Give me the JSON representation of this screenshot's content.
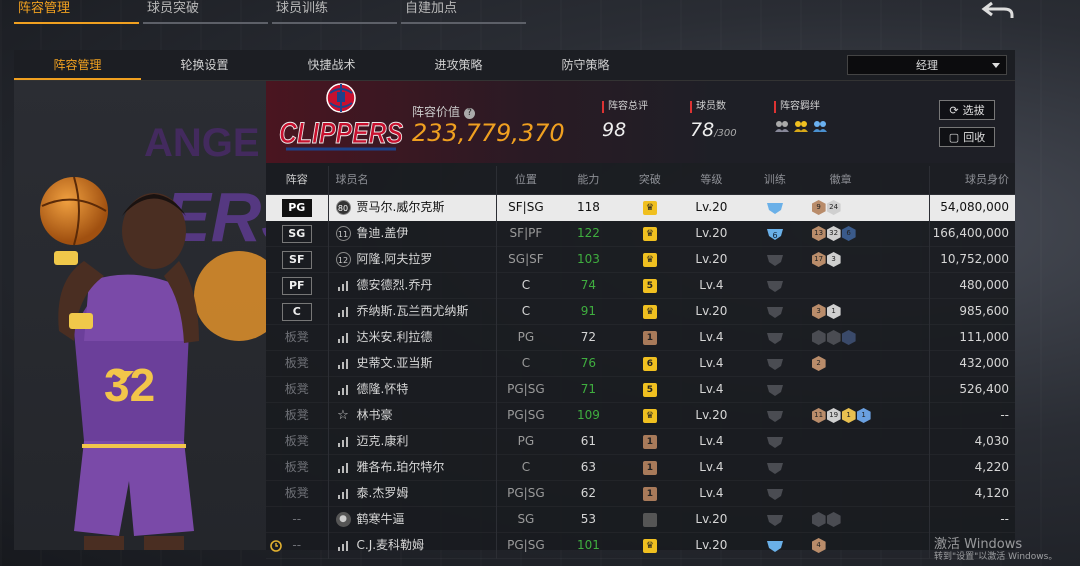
{
  "top_tabs": [
    {
      "label": "阵容管理",
      "active": true
    },
    {
      "label": "球员突破",
      "active": false
    },
    {
      "label": "球员训练",
      "active": false
    },
    {
      "label": "自建加点",
      "active": false
    }
  ],
  "sub_tabs": [
    {
      "label": "阵容管理",
      "active": true
    },
    {
      "label": "轮换设置",
      "active": false
    },
    {
      "label": "快捷战术",
      "active": false
    },
    {
      "label": "进攻策略",
      "active": false
    },
    {
      "label": "防守策略",
      "active": false
    }
  ],
  "manager_select": {
    "value": "经理"
  },
  "team": {
    "logo_text": "CLIPPERS",
    "value_label": "阵容价值",
    "value": "233,779,370",
    "rating_label": "阵容总评",
    "rating": "98",
    "count_label": "球员数",
    "count": "78",
    "count_max": "/300",
    "bond_label": "阵容羁绊"
  },
  "buttons": {
    "pick": "选拔",
    "recycle": "回收"
  },
  "player_art": {
    "jersey_number": "32",
    "bg_text": "ANGELES LAKERS"
  },
  "columns": [
    "阵容",
    "球员名",
    "位置",
    "能力",
    "突破",
    "等级",
    "训练",
    "徽章",
    "球员身价"
  ],
  "rows": [
    {
      "pos": "PG",
      "bench": false,
      "icon": "num",
      "num": "80",
      "name": "贾马尔.威尔克斯",
      "spos": "SF|SG",
      "abil": "118",
      "abil_color": "dark",
      "brk": "crown",
      "brk_color": "#f0c020",
      "lvl": "Lv.20",
      "train": "shield-blue",
      "badges": [
        {
          "t": "9",
          "c": "#b98c6a"
        },
        {
          "t": "24",
          "c": "#cfcfcf"
        }
      ],
      "value": "54,080,000",
      "selected": true
    },
    {
      "pos": "SG",
      "bench": false,
      "icon": "num",
      "num": "11",
      "name": "鲁迪.盖伊",
      "spos": "SF|PF",
      "abil": "122",
      "abil_color": "green",
      "brk": "crown",
      "brk_color": "#f0c020",
      "lvl": "Lv.20",
      "train": "shield-blue6",
      "badges": [
        {
          "t": "13",
          "c": "#b98c6a"
        },
        {
          "t": "32",
          "c": "#cfcfcf"
        },
        {
          "t": "6",
          "c": "#3a5a8a"
        }
      ],
      "value": "166,400,000",
      "selected": false
    },
    {
      "pos": "SF",
      "bench": false,
      "icon": "num",
      "num": "12",
      "name": "阿隆.阿夫拉罗",
      "spos": "SG|SF",
      "abil": "103",
      "abil_color": "green",
      "brk": "crown",
      "brk_color": "#f0c020",
      "lvl": "Lv.20",
      "train": "none",
      "badges": [
        {
          "t": "17",
          "c": "#b98c6a"
        },
        {
          "t": "3",
          "c": "#cfcfcf"
        }
      ],
      "value": "10,752,000",
      "selected": false
    },
    {
      "pos": "PF",
      "bench": false,
      "icon": "bars",
      "num": "",
      "name": "德安德烈.乔丹",
      "spos": "C",
      "abil": "74",
      "abil_color": "green",
      "brk": "5",
      "brk_color": "#f0c020",
      "lvl": "Lv.4",
      "train": "none",
      "badges": [],
      "value": "480,000",
      "selected": false
    },
    {
      "pos": "C",
      "bench": false,
      "icon": "bars",
      "num": "",
      "name": "乔纳斯.瓦兰西尤纳斯",
      "spos": "C",
      "abil": "91",
      "abil_color": "green",
      "brk": "crown",
      "brk_color": "#f0c020",
      "lvl": "Lv.20",
      "train": "none",
      "badges": [
        {
          "t": "3",
          "c": "#b98c6a"
        },
        {
          "t": "1",
          "c": "#cfcfcf"
        }
      ],
      "value": "985,600",
      "selected": false
    },
    {
      "pos": "板凳",
      "bench": true,
      "icon": "bars",
      "num": "",
      "name": "达米安.利拉德",
      "spos": "PG",
      "abil": "72",
      "abil_color": "plain",
      "brk": "1",
      "brk_color": "#a87a5a",
      "lvl": "Lv.4",
      "train": "none",
      "badges": [
        {
          "t": "",
          "c": "#4a4c52"
        },
        {
          "t": "",
          "c": "#4a4c52"
        },
        {
          "t": "",
          "c": "#3a4a6a"
        }
      ],
      "value": "111,000",
      "selected": false
    },
    {
      "pos": "板凳",
      "bench": true,
      "icon": "bars",
      "num": "",
      "name": "史蒂文.亚当斯",
      "spos": "C",
      "abil": "76",
      "abil_color": "green",
      "brk": "6",
      "brk_color": "#f0c020",
      "lvl": "Lv.4",
      "train": "none",
      "badges": [
        {
          "t": "2",
          "c": "#b98c6a"
        }
      ],
      "value": "432,000",
      "selected": false
    },
    {
      "pos": "板凳",
      "bench": true,
      "icon": "bars",
      "num": "",
      "name": "德隆.怀特",
      "spos": "PG|SG",
      "abil": "71",
      "abil_color": "green",
      "brk": "5",
      "brk_color": "#f0c020",
      "lvl": "Lv.4",
      "train": "none",
      "badges": [],
      "value": "526,400",
      "selected": false
    },
    {
      "pos": "板凳",
      "bench": true,
      "icon": "star",
      "num": "",
      "name": "林书豪",
      "spos": "PG|SG",
      "abil": "109",
      "abil_color": "green",
      "brk": "crown",
      "brk_color": "#f0c020",
      "lvl": "Lv.20",
      "train": "none",
      "badges": [
        {
          "t": "11",
          "c": "#b98c6a"
        },
        {
          "t": "19",
          "c": "#cfcfcf"
        },
        {
          "t": "1",
          "c": "#e8c050"
        },
        {
          "t": "1",
          "c": "#6aa0e0"
        }
      ],
      "value": "--",
      "selected": false
    },
    {
      "pos": "板凳",
      "bench": true,
      "icon": "bars",
      "num": "",
      "name": "迈克.康利",
      "spos": "PG",
      "abil": "61",
      "abil_color": "plain",
      "brk": "1",
      "brk_color": "#a87a5a",
      "lvl": "Lv.4",
      "train": "none",
      "badges": [],
      "value": "4,030",
      "selected": false
    },
    {
      "pos": "板凳",
      "bench": true,
      "icon": "bars",
      "num": "",
      "name": "雅各布.珀尔特尔",
      "spos": "C",
      "abil": "63",
      "abil_color": "plain",
      "brk": "1",
      "brk_color": "#a87a5a",
      "lvl": "Lv.4",
      "train": "none",
      "badges": [],
      "value": "4,220",
      "selected": false
    },
    {
      "pos": "板凳",
      "bench": true,
      "icon": "bars",
      "num": "",
      "name": "泰.杰罗姆",
      "spos": "PG|SG",
      "abil": "62",
      "abil_color": "plain",
      "brk": "1",
      "brk_color": "#a87a5a",
      "lvl": "Lv.4",
      "train": "none",
      "badges": [],
      "value": "4,120",
      "selected": false
    },
    {
      "pos": "--",
      "bench": true,
      "icon": "person",
      "num": "",
      "name": "鹤寒牛逼",
      "spos": "SG",
      "abil": "53",
      "abil_color": "plain",
      "brk": "empty",
      "brk_color": "#555",
      "lvl": "Lv.20",
      "train": "none",
      "badges": [
        {
          "t": "",
          "c": "#4a4c52"
        },
        {
          "t": "",
          "c": "#4a4c52"
        }
      ],
      "value": "--",
      "selected": false
    },
    {
      "pos": "--",
      "bench": true,
      "icon": "bars",
      "num": "",
      "name": "C.J.麦科勒姆",
      "spos": "PG|SG",
      "abil": "101",
      "abil_color": "green",
      "brk": "crown",
      "brk_color": "#f0c020",
      "lvl": "Lv.20",
      "train": "shield-blue",
      "badges": [
        {
          "t": "4",
          "c": "#b98c6a"
        }
      ],
      "value": "",
      "selected": false,
      "alarm": true
    }
  ],
  "watermark": {
    "line1": "激活 Windows",
    "line2": "转到\"设置\"以激活 Windows。"
  },
  "colors": {
    "accent": "#f0a020",
    "ability_green": "#3fae3f",
    "team_red": "#c8102e",
    "team_blue": "#1d428a"
  }
}
